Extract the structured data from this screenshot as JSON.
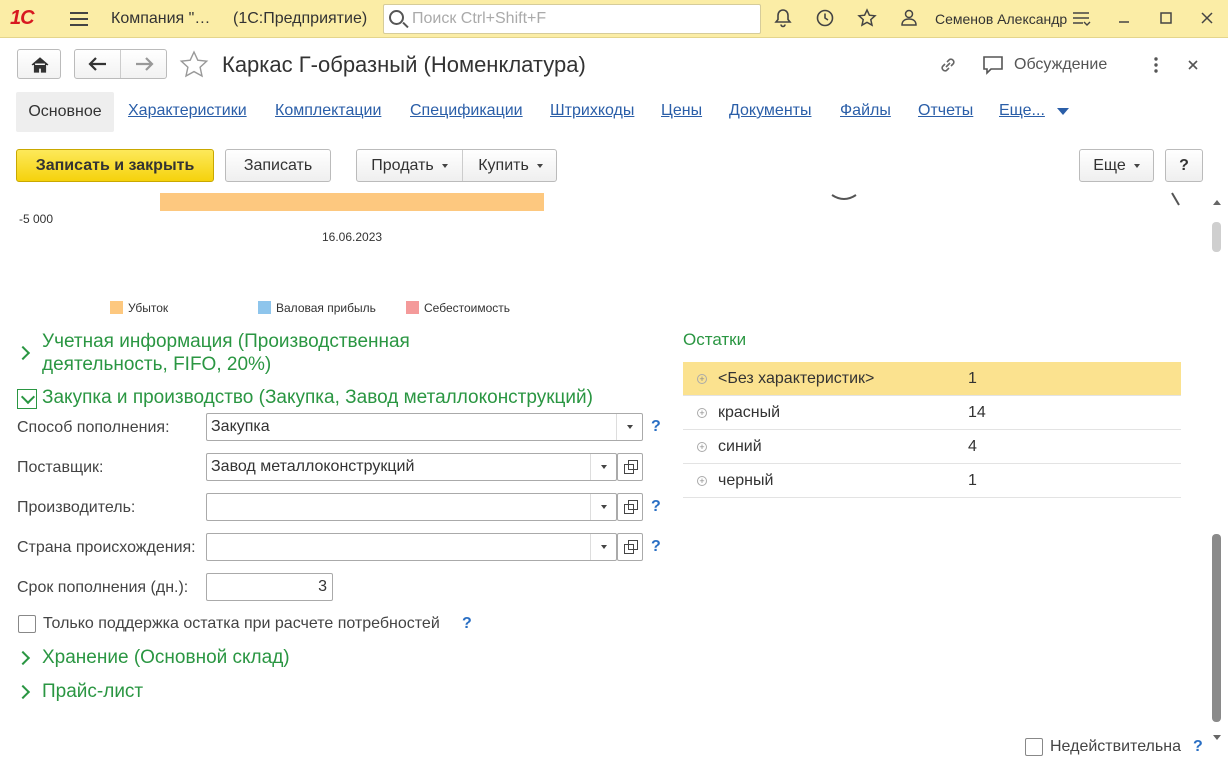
{
  "window": {
    "logo": "1С",
    "company": "Компания \"…",
    "app": "(1С:Предприятие)",
    "search_placeholder": "Поиск Ctrl+Shift+F",
    "user": "Семенов Александр"
  },
  "header": {
    "title": "Каркас Г-образный (Номенклатура)",
    "discussion": "Обсуждение"
  },
  "tabs": {
    "active": "Основное",
    "items": [
      "Характеристики",
      "Комплектации",
      "Спецификации",
      "Штрихкоды",
      "Цены",
      "Документы",
      "Файлы",
      "Отчеты",
      "Еще..."
    ]
  },
  "commands": {
    "save_close": "Записать и закрыть",
    "save": "Записать",
    "sell": "Продать",
    "buy": "Купить",
    "more": "Еще",
    "help": "?"
  },
  "chart": {
    "y_tick": "-5 000",
    "x_tick": "16.06.2023",
    "legend": [
      {
        "name": "Убыток",
        "color": "#fdc87f"
      },
      {
        "name": "Валовая прибыль",
        "color": "#8ec5ec"
      },
      {
        "name": "Себестоимость",
        "color": "#f49a9a"
      }
    ],
    "bar_color": "#fdc87f"
  },
  "groups": {
    "accounting_line1": "Учетная информация (Производственная",
    "accounting_line2": "деятельность, FIFO, 20%)",
    "purchase": "Закупка и производство (Закупка, Завод металлоконструкций)",
    "storage": "Хранение (Основной склад)",
    "pricelist": "Прайс-лист"
  },
  "form": {
    "replenish_method_label": "Способ пополнения:",
    "replenish_method_value": "Закупка",
    "supplier_label": "Поставщик:",
    "supplier_value": "Завод металлоконструкций",
    "manufacturer_label": "Производитель:",
    "manufacturer_value": "",
    "country_label": "Страна происхождения:",
    "country_value": "",
    "term_label": "Срок пополнения (дн.):",
    "term_value": "3",
    "stock_only_label": "Только поддержка остатка при расчете потребностей",
    "help_mark": "?",
    "inactive_label": "Недействительна"
  },
  "stock": {
    "title": "Остатки",
    "rows": [
      {
        "name": "<Без характеристик>",
        "qty": "1"
      },
      {
        "name": "красный",
        "qty": "14"
      },
      {
        "name": "синий",
        "qty": "4"
      },
      {
        "name": "черный",
        "qty": "1"
      }
    ]
  },
  "colors": {
    "accent_green": "#2a9642",
    "link_blue": "#2a5ea8",
    "titlebar": "#fbeda6",
    "primary_button": "#f5d20c",
    "selected_row": "#fbe28f"
  }
}
